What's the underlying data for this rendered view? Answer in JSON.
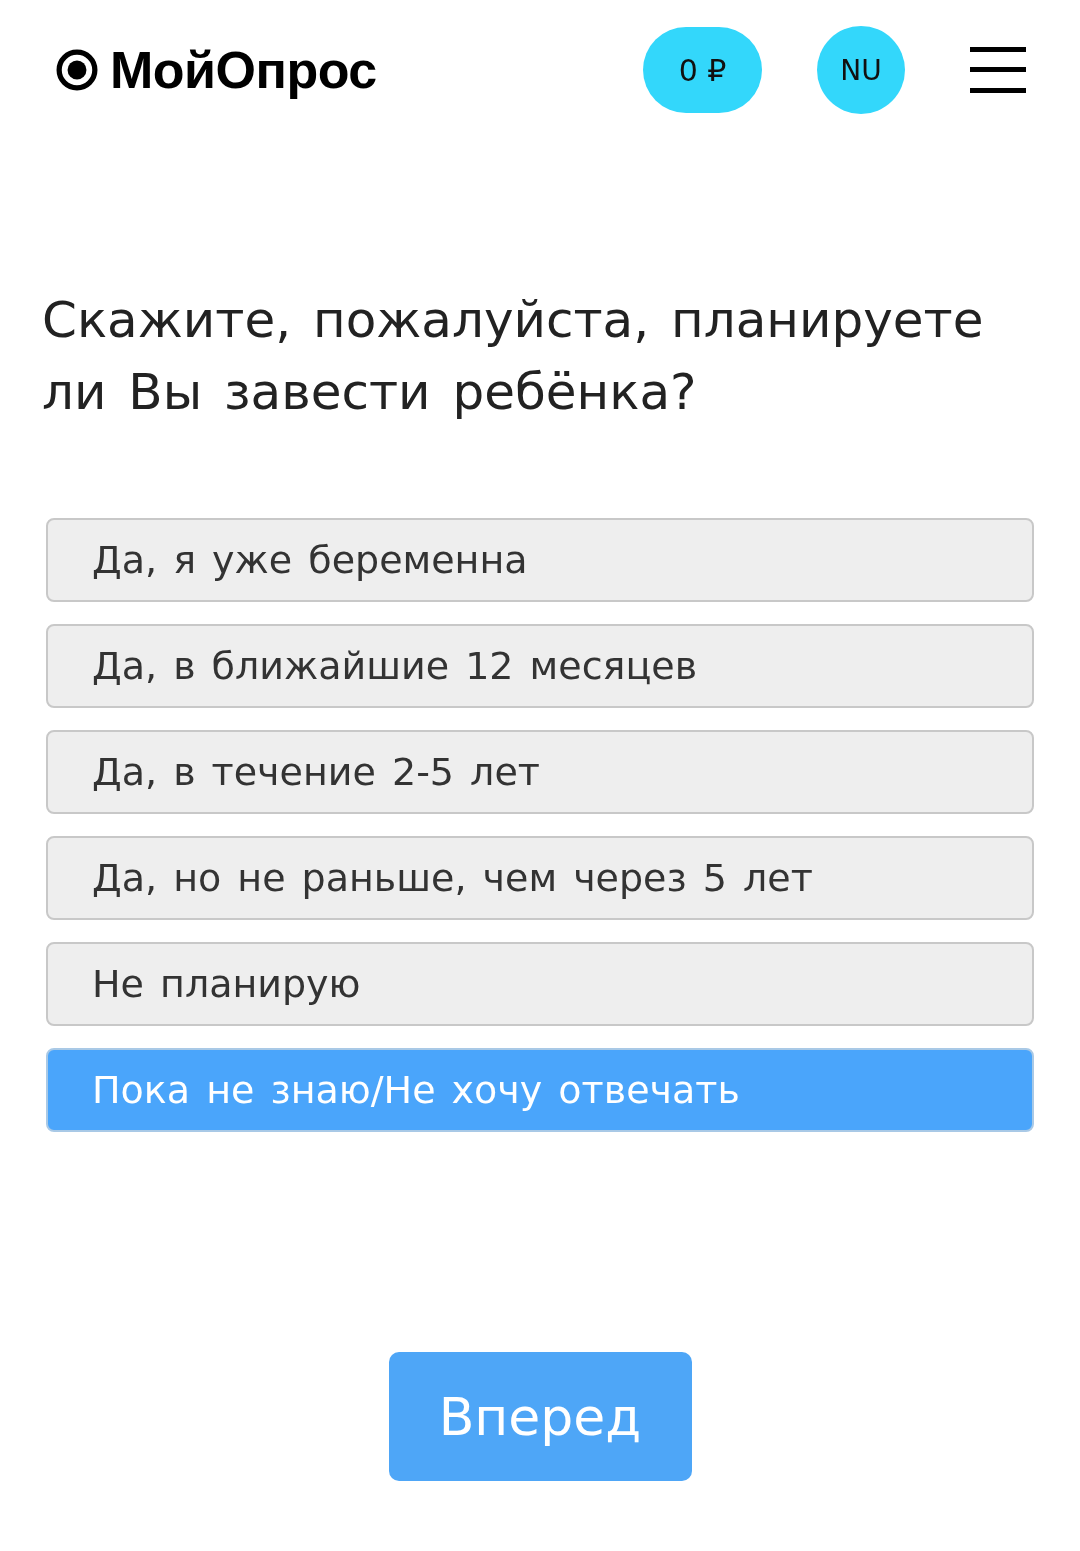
{
  "header": {
    "logo": "МойОпрос",
    "balance": "0 ₽",
    "avatar": "NU"
  },
  "question": "Скажите, пожалуйста, планируете ли Вы завести ребёнка?",
  "options": [
    {
      "label": "Да, я уже беременна",
      "selected": false
    },
    {
      "label": "Да, в ближайшие 12 месяцев",
      "selected": false
    },
    {
      "label": "Да, в течение 2-5 лет",
      "selected": false
    },
    {
      "label": "Да, но не раньше, чем через 5 лет",
      "selected": false
    },
    {
      "label": "Не планирую",
      "selected": false
    },
    {
      "label": "Пока не знаю/Не хочу отвечать",
      "selected": true
    }
  ],
  "next_button": "Вперед"
}
